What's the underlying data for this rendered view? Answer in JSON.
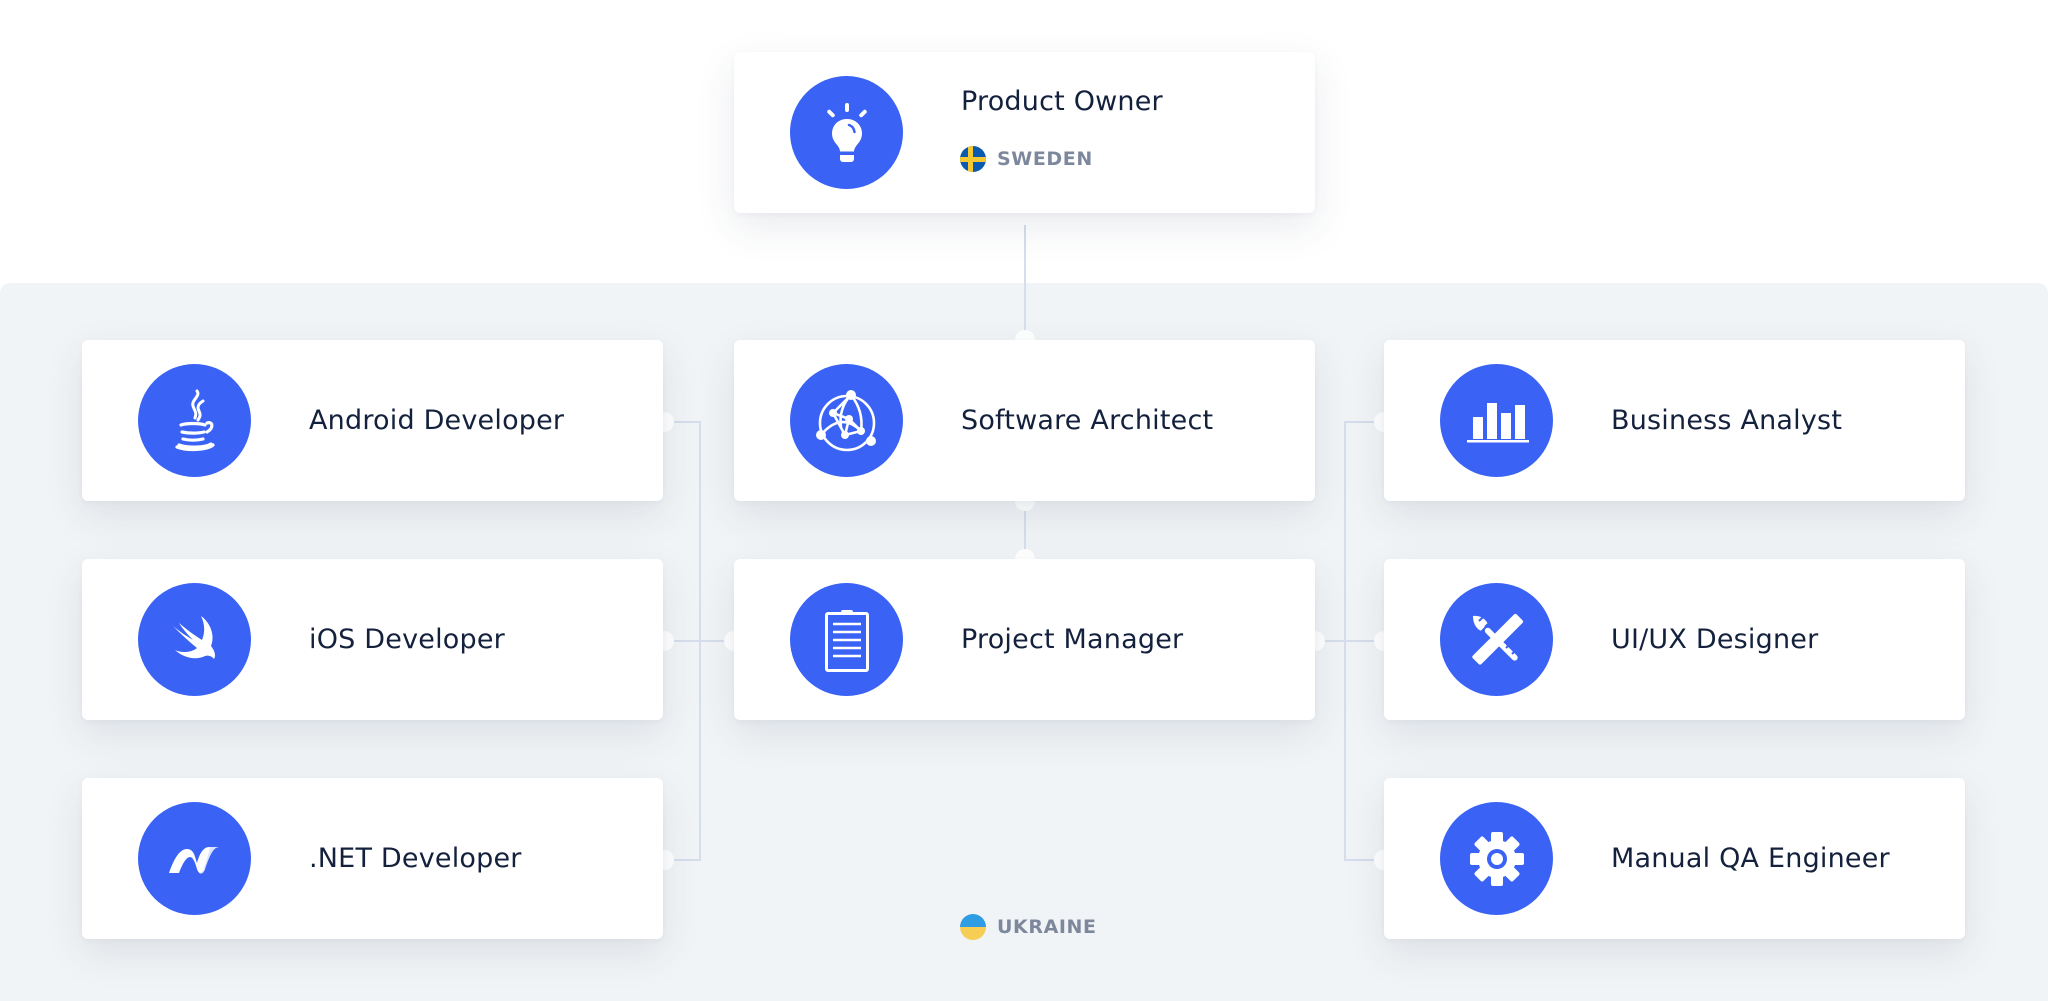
{
  "colors": {
    "accent": "#3a63f5",
    "panel_bg": "#f1f4f6",
    "card_bg": "#ffffff",
    "title_text": "#14213d",
    "country_text": "#7d889d",
    "connector": "#d6ddec"
  },
  "top": {
    "card": {
      "title": "Product Owner",
      "icon": "lightbulb-icon"
    },
    "country": {
      "label": "SWEDEN",
      "flag": "sweden-flag-icon"
    }
  },
  "team": {
    "country": {
      "label": "UKRAINE",
      "flag": "ukraine-flag-icon"
    },
    "left_column": [
      {
        "title": "Android Developer",
        "icon": "java-icon"
      },
      {
        "title": "iOS Developer",
        "icon": "swift-icon"
      },
      {
        "title": ".NET Developer",
        "icon": "dotnet-icon"
      }
    ],
    "center_column": [
      {
        "title": "Software Architect",
        "icon": "network-globe-icon"
      },
      {
        "title": "Project Manager",
        "icon": "clipboard-icon"
      }
    ],
    "right_column": [
      {
        "title": "Business Analyst",
        "icon": "bar-chart-icon"
      },
      {
        "title": "UI/UX Designer",
        "icon": "ruler-brush-icon"
      },
      {
        "title": "Manual QA Engineer",
        "icon": "gear-icon"
      }
    ]
  }
}
